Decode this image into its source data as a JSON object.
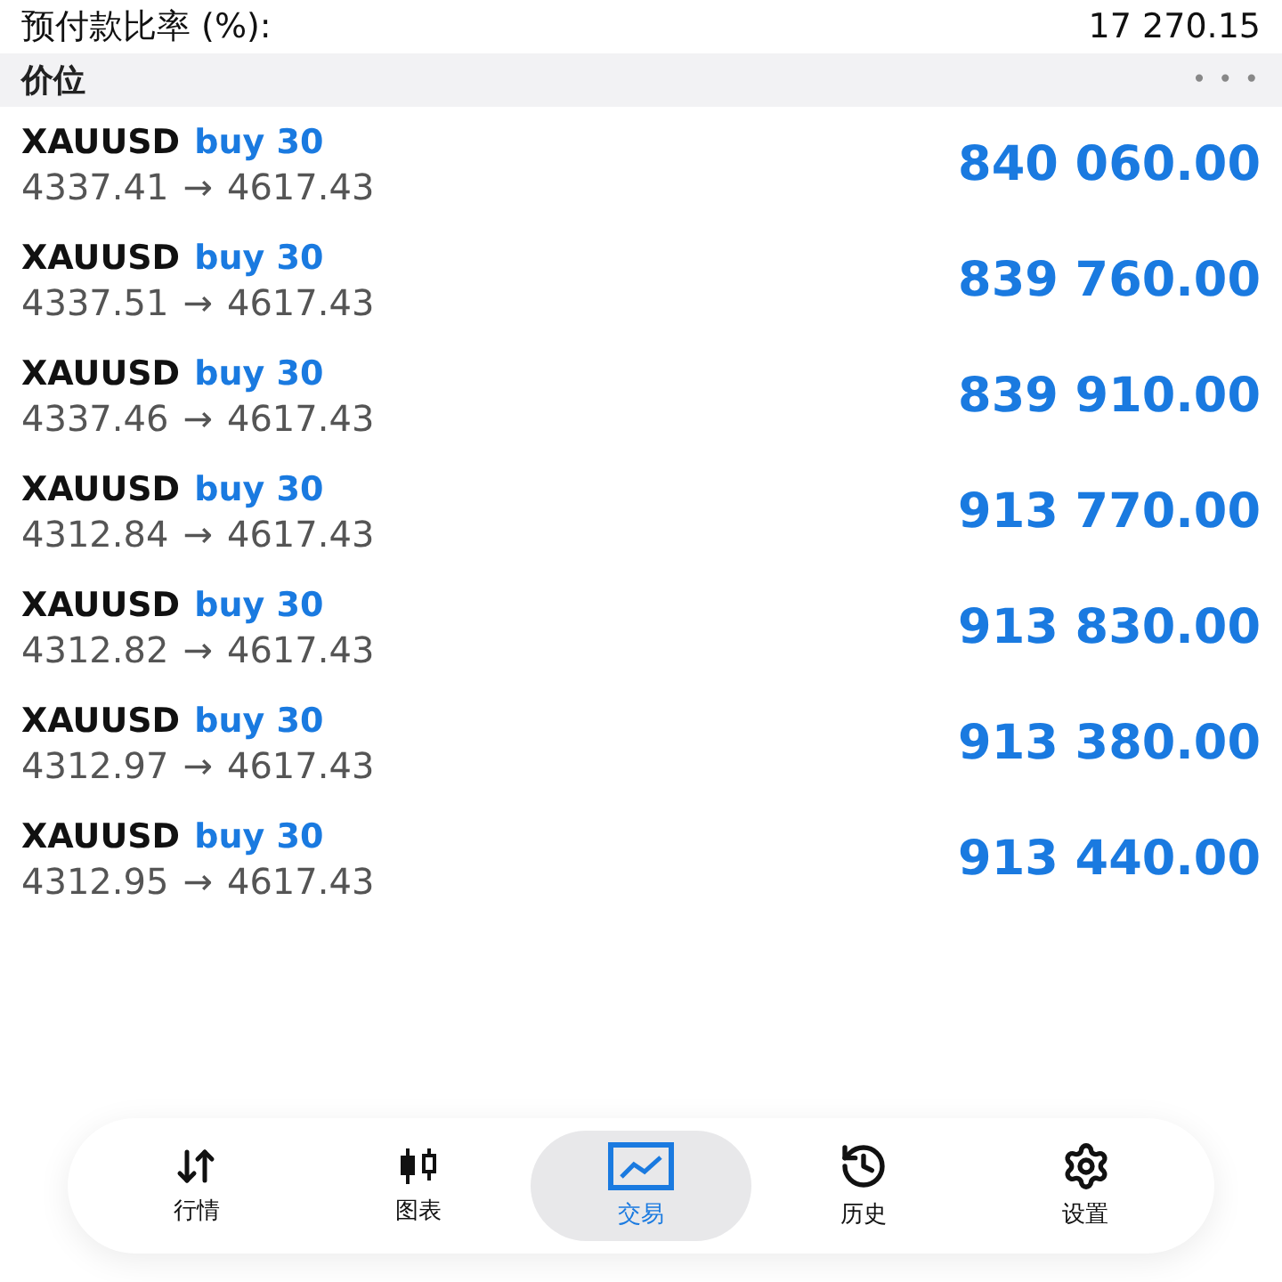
{
  "summary": {
    "label": "预付款比率 (%):",
    "value": "17 270.15"
  },
  "section": {
    "title": "价位",
    "more": "• • •"
  },
  "positions": [
    {
      "symbol": "XAUUSD",
      "order": "buy 30",
      "open": "4337.41",
      "arrow": "→",
      "current": "4617.43",
      "profit": "840 060.00"
    },
    {
      "symbol": "XAUUSD",
      "order": "buy 30",
      "open": "4337.51",
      "arrow": "→",
      "current": "4617.43",
      "profit": "839 760.00"
    },
    {
      "symbol": "XAUUSD",
      "order": "buy 30",
      "open": "4337.46",
      "arrow": "→",
      "current": "4617.43",
      "profit": "839 910.00"
    },
    {
      "symbol": "XAUUSD",
      "order": "buy 30",
      "open": "4312.84",
      "arrow": "→",
      "current": "4617.43",
      "profit": "913 770.00"
    },
    {
      "symbol": "XAUUSD",
      "order": "buy 30",
      "open": "4312.82",
      "arrow": "→",
      "current": "4617.43",
      "profit": "913 830.00"
    },
    {
      "symbol": "XAUUSD",
      "order": "buy 30",
      "open": "4312.97",
      "arrow": "→",
      "current": "4617.43",
      "profit": "913 380.00"
    },
    {
      "symbol": "XAUUSD",
      "order": "buy 30",
      "open": "4312.95",
      "arrow": "→",
      "current": "4617.43",
      "profit": "913 440.00"
    }
  ],
  "tabs": [
    {
      "label": "行情",
      "kind": "quotes",
      "selected": false
    },
    {
      "label": "图表",
      "kind": "chart",
      "selected": false
    },
    {
      "label": "交易",
      "kind": "trade",
      "selected": true
    },
    {
      "label": "历史",
      "kind": "history",
      "selected": false
    },
    {
      "label": "设置",
      "kind": "settings",
      "selected": false
    }
  ]
}
